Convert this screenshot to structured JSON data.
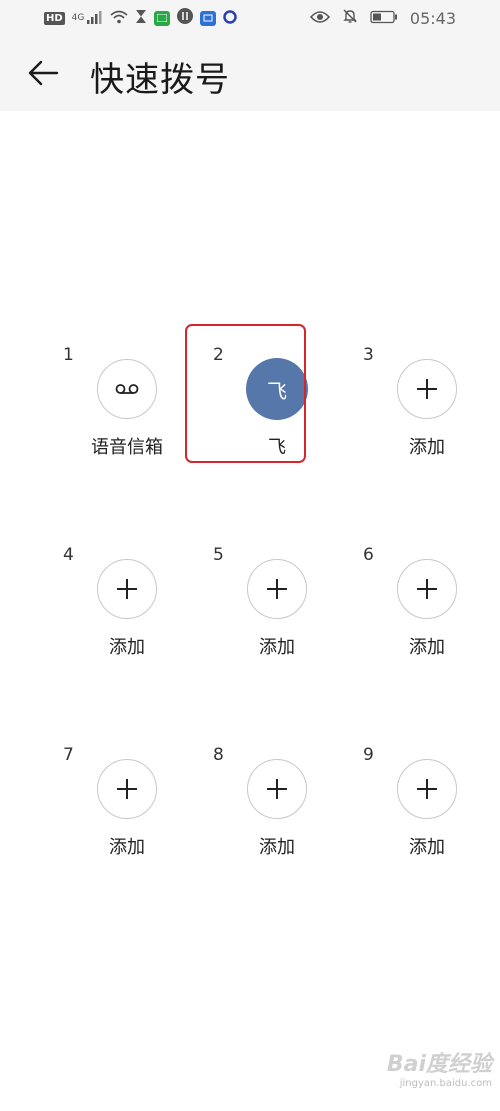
{
  "status_bar": {
    "hd_label": "HD",
    "network_label": "4G",
    "time": "05:43"
  },
  "header": {
    "title": "快速拨号"
  },
  "slots": [
    {
      "number": "1",
      "label": "语音信箱",
      "kind": "voicemail"
    },
    {
      "number": "2",
      "label": "飞",
      "kind": "contact",
      "avatar": "飞"
    },
    {
      "number": "3",
      "label": "添加",
      "kind": "add"
    },
    {
      "number": "4",
      "label": "添加",
      "kind": "add"
    },
    {
      "number": "5",
      "label": "添加",
      "kind": "add"
    },
    {
      "number": "6",
      "label": "添加",
      "kind": "add"
    },
    {
      "number": "7",
      "label": "添加",
      "kind": "add"
    },
    {
      "number": "8",
      "label": "添加",
      "kind": "add"
    },
    {
      "number": "9",
      "label": "添加",
      "kind": "add"
    }
  ],
  "watermark": {
    "logo": "Bai度经验",
    "url": "jingyan.baidu.com"
  },
  "colors": {
    "avatar_bg": "#5577a9",
    "highlight_border": "#d6262c",
    "header_bg": "#f5f5f5"
  }
}
